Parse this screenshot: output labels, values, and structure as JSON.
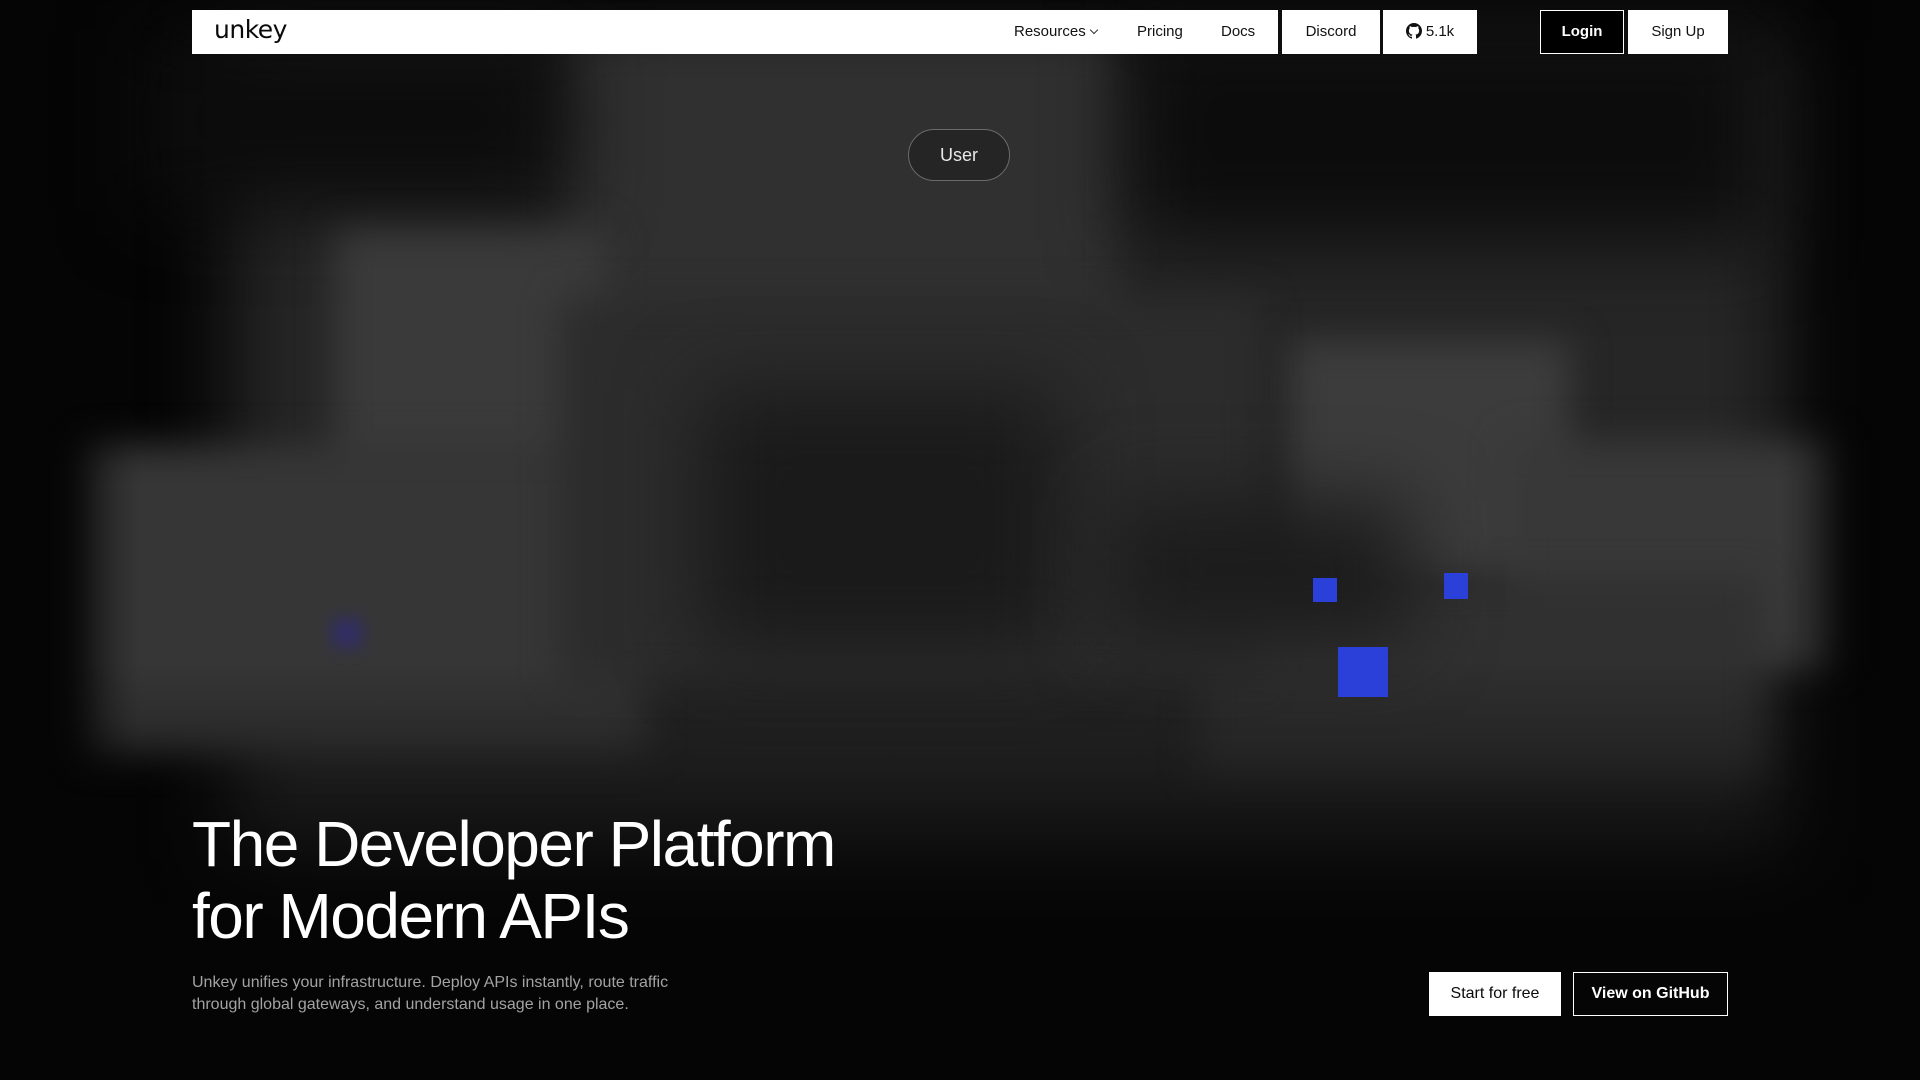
{
  "nav": {
    "logo": "unkey",
    "resources_label": "Resources",
    "pricing_label": "Pricing",
    "docs_label": "Docs",
    "discord_label": "Discord",
    "github_stars": "5.1k",
    "login_label": "Login",
    "signup_label": "Sign Up"
  },
  "art": {
    "pill_label": "User",
    "accent_color": "#2b3fd9"
  },
  "hero": {
    "title_line1": "The Developer Platform",
    "title_line2": "for Modern APIs",
    "subtitle_line1": "Unkey unifies your infrastructure. Deploy APIs instantly, route traffic",
    "subtitle_line2": "through global gateways, and understand usage in one place.",
    "cta_primary": "Start for free",
    "cta_secondary": "View on GitHub"
  }
}
